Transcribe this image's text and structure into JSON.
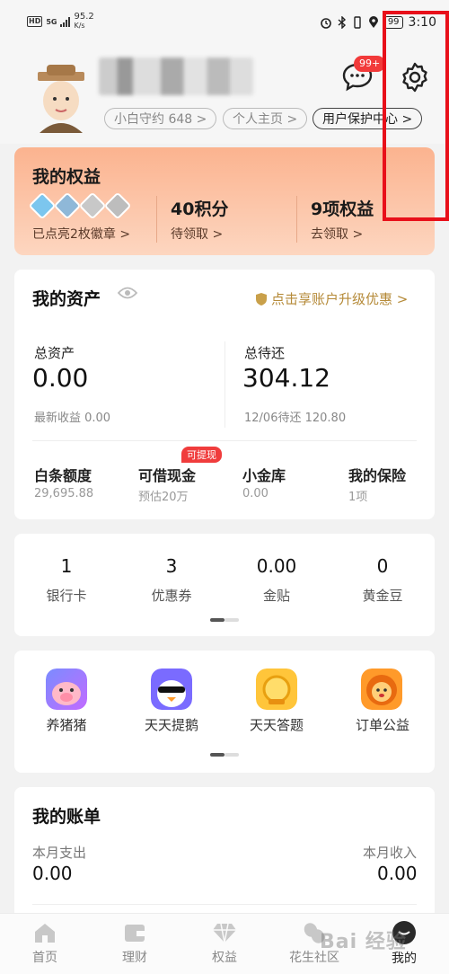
{
  "status_bar": {
    "hd": "HD",
    "network": "5G",
    "speed": "95.2",
    "speed_unit": "K/s",
    "battery": "99",
    "time": "3:10"
  },
  "profile": {
    "chips": [
      {
        "label": "小白守约 648 >"
      },
      {
        "label": "个人主页 >"
      },
      {
        "label": "用户保护中心 >"
      }
    ],
    "message_badge": "99+"
  },
  "rights": {
    "title": "我的权益",
    "medals_link": "已点亮2枚徽章 >",
    "points_value": "40积分",
    "points_link": "待领取 >",
    "benefits_value": "9项权益",
    "benefits_link": "去领取 >",
    "medal_colors": [
      "#7cc6ee",
      "#8fb8d8",
      "#c8c8c8",
      "#bdbdbd"
    ]
  },
  "assets": {
    "title": "我的资产",
    "upgrade_link": "点击享账户升级优惠 >",
    "total_label": "总资产",
    "total_value": "0.00",
    "total_sub": "最新收益 0.00",
    "repay_label": "总待还",
    "repay_value": "304.12",
    "repay_sub": "12/06待还 120.80",
    "quick": [
      {
        "title": "白条额度",
        "sub": "29,695.88"
      },
      {
        "title": "可借现金",
        "sub": "预估20万",
        "tag": "可提现"
      },
      {
        "title": "小金库",
        "sub": "0.00"
      },
      {
        "title": "我的保险",
        "sub": "1项"
      }
    ]
  },
  "stats": [
    {
      "value": "1",
      "label": "银行卡"
    },
    {
      "value": "3",
      "label": "优惠券"
    },
    {
      "value": "0.00",
      "label": "金贴"
    },
    {
      "value": "0",
      "label": "黄金豆"
    }
  ],
  "apps": [
    {
      "label": "养猪猪",
      "icon": "pig-icon"
    },
    {
      "label": "天天提鹅",
      "icon": "goose-icon"
    },
    {
      "label": "天天答题",
      "icon": "quiz-icon"
    },
    {
      "label": "订单公益",
      "icon": "lion-icon"
    }
  ],
  "bill": {
    "title": "我的账单",
    "expense_label": "本月支出",
    "expense_value": "0.00",
    "income_label": "本月收入",
    "income_value": "0.00"
  },
  "tabs": [
    {
      "label": "首页",
      "icon": "home-icon"
    },
    {
      "label": "理财",
      "icon": "wallet-icon"
    },
    {
      "label": "权益",
      "icon": "diamond-icon"
    },
    {
      "label": "花生社区",
      "icon": "peanut-icon"
    },
    {
      "label": "我的",
      "icon": "profile-icon"
    }
  ],
  "watermark": "Bai 经验",
  "accent": "#e8101a"
}
